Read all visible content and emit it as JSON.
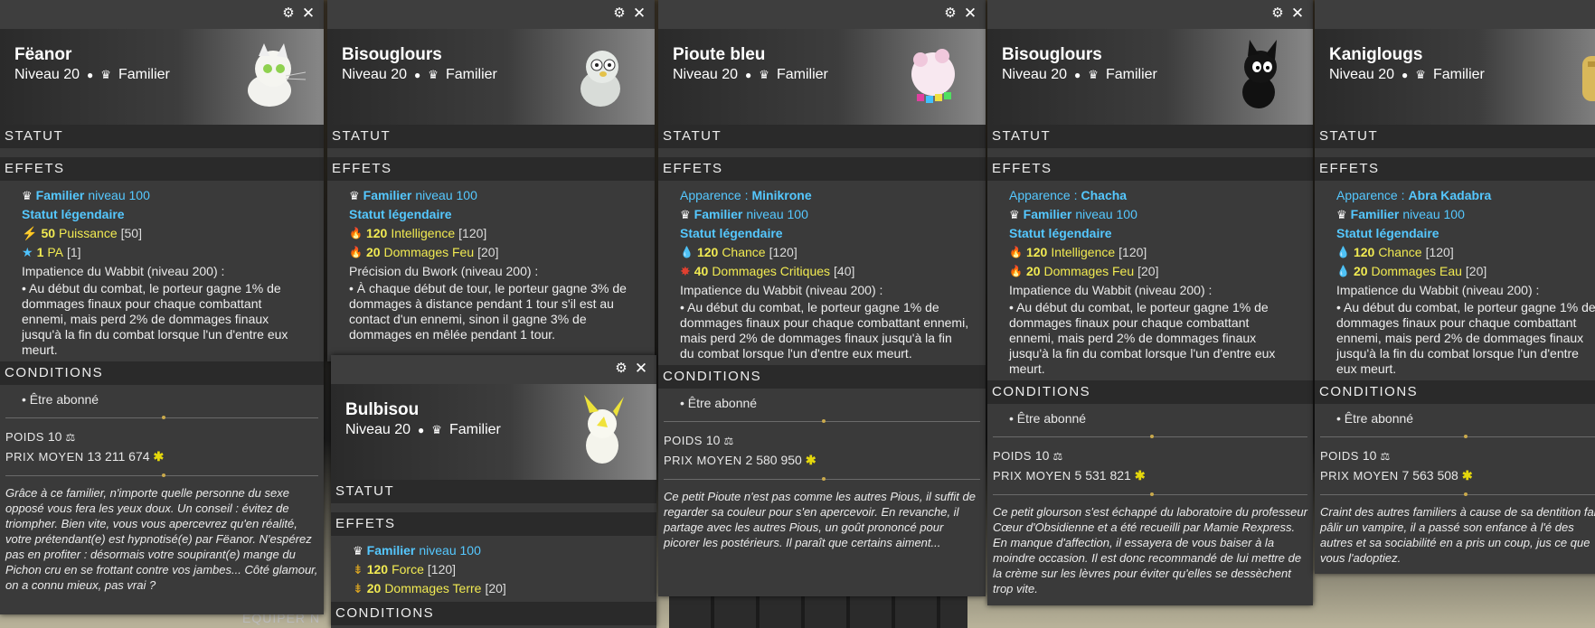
{
  "labels": {
    "level": "Niveau 20",
    "type": "Familier",
    "statut": "STATUT",
    "effets": "EFFETS",
    "conditions": "CONDITIONS",
    "poids": "POIDS",
    "prix": "PRIX MOYEN",
    "abonne": "• Être abonné",
    "familier": "Familier",
    "niveau100": "niveau 100",
    "legendaire": "Statut légendaire",
    "apparence": "Apparence :",
    "impatience_title": "Impatience du Wabbit (niveau 200) :",
    "impatience_text": "• Au début du combat, le porteur gagne 1% de dommages finaux pour chaque combattant ennemi, mais perd 2% de dommages finaux jusqu'à la fin du combat lorsque l'un d'entre eux meurt.",
    "bg_label": "ÉQUIPER N"
  },
  "cards": {
    "feanor": {
      "name": "Fëanor",
      "stats": [
        {
          "icon": "⚡",
          "val": "50",
          "name": "Puissance",
          "bracket": "[50]"
        },
        {
          "icon": "★",
          "val": "1",
          "name": "PA",
          "bracket": "[1]"
        }
      ],
      "weight": "10",
      "price": "13 211 674",
      "lore": "Grâce à ce familier, n'importe quelle personne du sexe opposé vous fera les yeux doux. Un conseil : évitez de triompher. Bien vite, vous vous apercevrez qu'en réalité, votre prétendant(e) est hypnotisé(e) par Fëanor. N'espérez pas en profiter : désormais votre soupirant(e) mange du Pichon cru en se frottant contre vos jambes... Côté glamour, on a connu mieux, pas vrai ?"
    },
    "bisou1": {
      "name": "Bisouglours",
      "stats": [
        {
          "icon": "🔥",
          "val": "120",
          "name": "Intelligence",
          "bracket": "[120]"
        },
        {
          "icon": "🔥",
          "val": "20",
          "name": "Dommages Feu",
          "bracket": "[20]"
        }
      ],
      "skill_title": "Précision du Bwork (niveau 200) :",
      "skill_text": "• À chaque début de tour, le porteur gagne 3% de dommages à distance pendant 1 tour s'il est au contact d'un ennemi, sinon il gagne 3% de dommages en mêlée pendant 1 tour."
    },
    "bulbisou": {
      "name": "Bulbisou",
      "stats": [
        {
          "icon": "⇟",
          "val": "120",
          "name": "Force",
          "bracket": "[120]"
        },
        {
          "icon": "⇟",
          "val": "20",
          "name": "Dommages Terre",
          "bracket": "[20]"
        }
      ]
    },
    "pioute": {
      "name": "Pioute bleu",
      "appearance": "Minikrone",
      "stats": [
        {
          "icon": "💧",
          "val": "120",
          "name": "Chance",
          "bracket": "[120]"
        },
        {
          "icon": "✸",
          "val": "40",
          "name": "Dommages Critiques",
          "bracket": "[40]"
        }
      ],
      "weight": "10",
      "price": "2 580 950",
      "lore": "Ce petit Pioute n'est pas comme les autres Pious, il suffit de regarder sa couleur pour s'en apercevoir. En revanche, il partage avec les autres Pious, un goût prononcé pour picorer les postérieurs. Il paraît que certains aiment..."
    },
    "bisou2": {
      "name": "Bisouglours",
      "appearance": "Chacha",
      "stats": [
        {
          "icon": "🔥",
          "val": "120",
          "name": "Intelligence",
          "bracket": "[120]"
        },
        {
          "icon": "🔥",
          "val": "20",
          "name": "Dommages Feu",
          "bracket": "[20]"
        }
      ],
      "weight": "10",
      "price": "5 531 821",
      "lore": "Ce petit glourson s'est échappé du laboratoire du professeur Cœur d'Obsidienne et a été recueilli par Mamie Rexpress. En manque d'affection, il essayera de vous baiser à la moindre occasion. Il est donc recommandé de lui mettre de la crème sur les lèvres pour éviter qu'elles se dessèchent trop vite."
    },
    "kani": {
      "name": "Kaniglougs",
      "appearance": "Abra Kadabra",
      "stats": [
        {
          "icon": "💧",
          "val": "120",
          "name": "Chance",
          "bracket": "[120]"
        },
        {
          "icon": "💧",
          "val": "20",
          "name": "Dommages Eau",
          "bracket": "[20]"
        }
      ],
      "weight": "10",
      "price": "7 563 508",
      "lore": "Craint des autres familiers à cause de sa dentition faire pâlir un vampire, il a passé son enfance à l'é des autres et sa sociabilité en a pris un coup, jus ce que vous l'adoptiez."
    }
  },
  "colors": {
    "accent_blue": "#55c8ff",
    "accent_yellow": "#f1ea52",
    "kama": "#e5d80c"
  }
}
